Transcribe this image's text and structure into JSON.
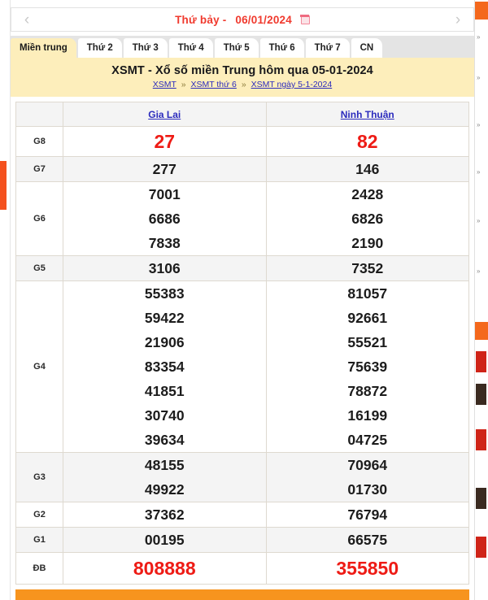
{
  "datebar": {
    "prev_label": "‹",
    "next_label": "›",
    "weekday": "Thứ bảy -",
    "date": "06/01/2024",
    "calendar_icon": "calendar-icon"
  },
  "tabs": [
    {
      "label": "Miền trung",
      "active": true
    },
    {
      "label": "Thứ 2",
      "active": false
    },
    {
      "label": "Thứ 3",
      "active": false
    },
    {
      "label": "Thứ 4",
      "active": false
    },
    {
      "label": "Thứ 5",
      "active": false
    },
    {
      "label": "Thứ 6",
      "active": false
    },
    {
      "label": "Thứ 7",
      "active": false
    },
    {
      "label": "CN",
      "active": false
    }
  ],
  "title": "XSMT - Xổ số miền Trung hôm qua 05-01-2024",
  "breadcrumb": {
    "items": [
      "XSMT",
      "XSMT thứ 6",
      "XSMT ngày 5-1-2024"
    ],
    "separator": "»"
  },
  "table": {
    "columns": [
      "",
      "Gia Lai",
      "Ninh Thuận"
    ],
    "rows": [
      {
        "label": "G8",
        "gia_lai": [
          "27"
        ],
        "ninh_thuan": [
          "82"
        ],
        "style": "red",
        "shade": false
      },
      {
        "label": "G7",
        "gia_lai": [
          "277"
        ],
        "ninh_thuan": [
          "146"
        ],
        "style": "normal",
        "shade": true
      },
      {
        "label": "G6",
        "gia_lai": [
          "7001",
          "6686",
          "7838"
        ],
        "ninh_thuan": [
          "2428",
          "6826",
          "2190"
        ],
        "style": "normal",
        "shade": false
      },
      {
        "label": "G5",
        "gia_lai": [
          "3106"
        ],
        "ninh_thuan": [
          "7352"
        ],
        "style": "normal",
        "shade": true
      },
      {
        "label": "G4",
        "gia_lai": [
          "55383",
          "59422",
          "21906",
          "83354",
          "41851",
          "30740",
          "39634"
        ],
        "ninh_thuan": [
          "81057",
          "92661",
          "55521",
          "75639",
          "78872",
          "16199",
          "04725"
        ],
        "style": "normal",
        "shade": false
      },
      {
        "label": "G3",
        "gia_lai": [
          "48155",
          "49922"
        ],
        "ninh_thuan": [
          "70964",
          "01730"
        ],
        "style": "normal",
        "shade": true
      },
      {
        "label": "G2",
        "gia_lai": [
          "37362"
        ],
        "ninh_thuan": [
          "76794"
        ],
        "style": "normal",
        "shade": false
      },
      {
        "label": "G1",
        "gia_lai": [
          "00195"
        ],
        "ninh_thuan": [
          "66575"
        ],
        "style": "normal",
        "shade": true
      },
      {
        "label": "ĐB",
        "gia_lai": [
          "808888"
        ],
        "ninh_thuan": [
          "355850"
        ],
        "style": "red-big",
        "shade": false
      }
    ]
  },
  "colors": {
    "accent_red": "#ee1b15",
    "panel_yellow": "#fdeebb",
    "link_blue": "#2b2bbd",
    "orange_bar": "#f7941e",
    "row_shade": "#f4f4f4"
  }
}
